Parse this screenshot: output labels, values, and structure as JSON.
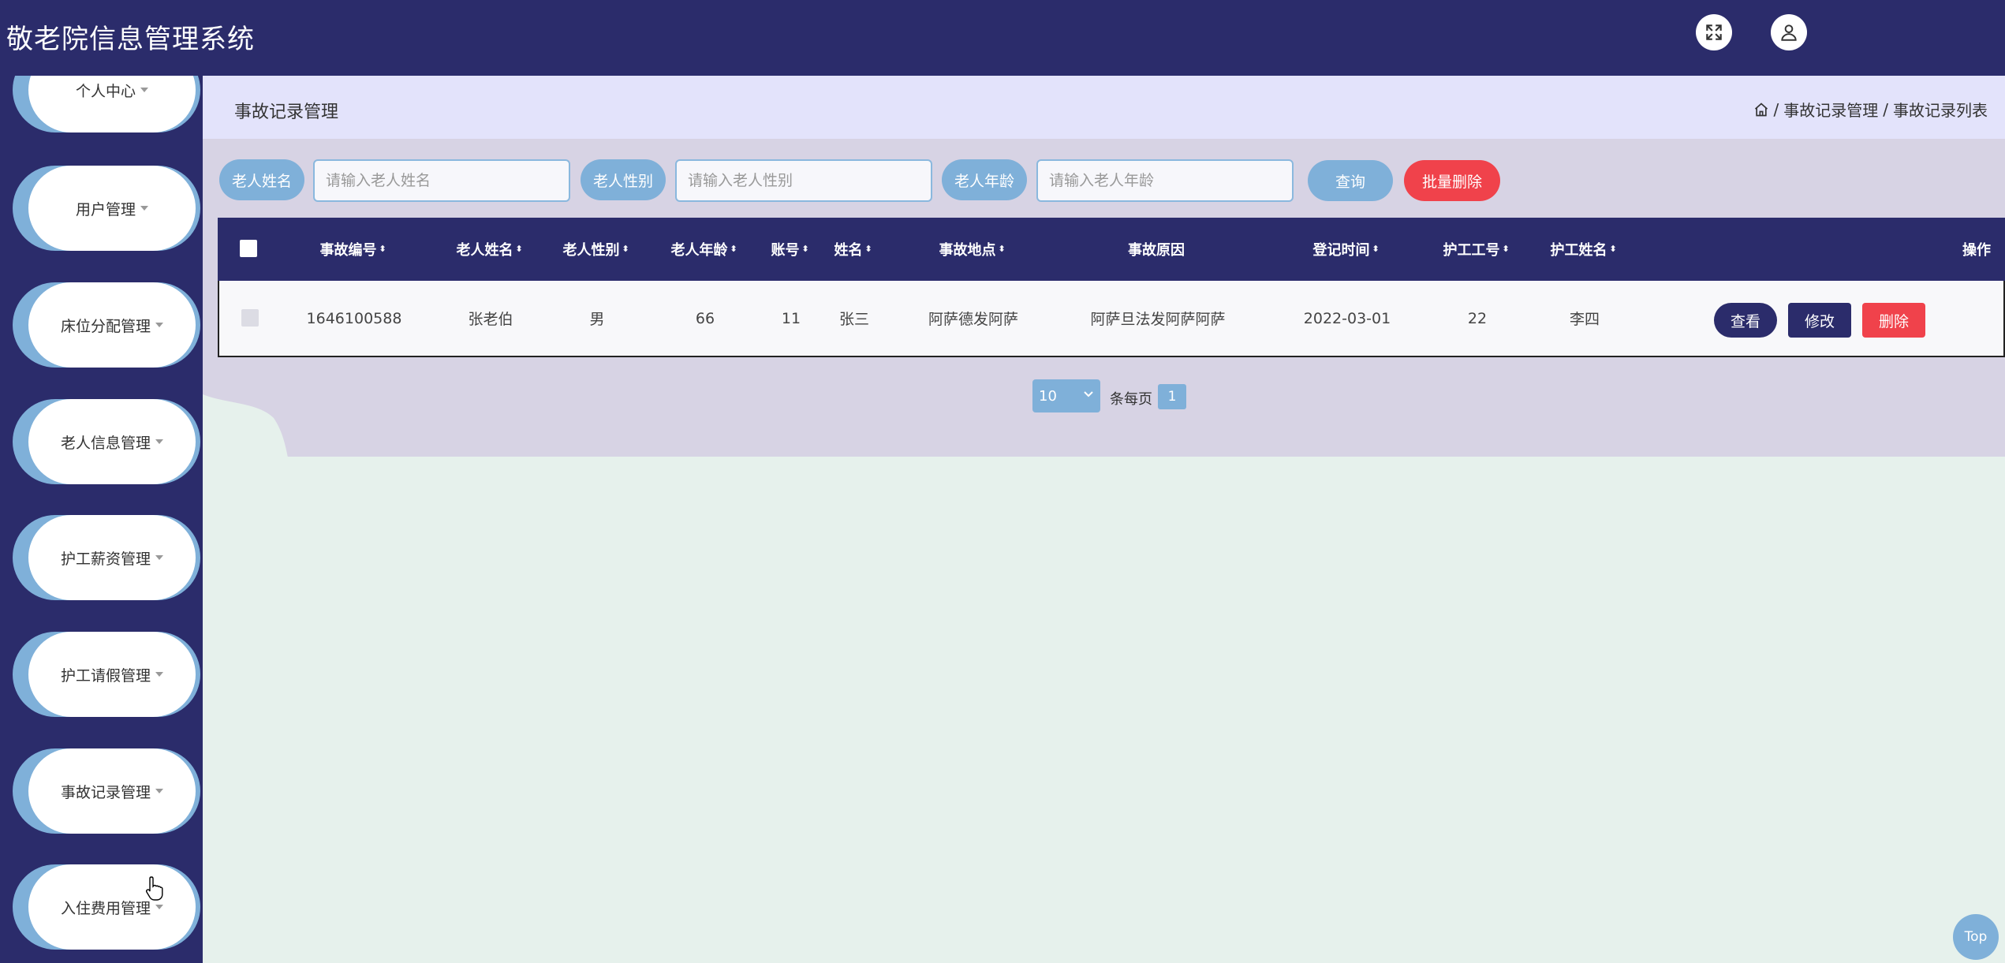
{
  "app": {
    "title": "敬老院信息管理系统"
  },
  "topbar": {
    "fullscreen_icon": "fullscreen-icon",
    "user_icon": "user-icon"
  },
  "sidebar": {
    "items": [
      {
        "label": "个人中心"
      },
      {
        "label": "用户管理"
      },
      {
        "label": "床位分配管理"
      },
      {
        "label": "老人信息管理"
      },
      {
        "label": "护工薪资管理"
      },
      {
        "label": "护工请假管理"
      },
      {
        "label": "事故记录管理"
      },
      {
        "label": "入住费用管理"
      }
    ]
  },
  "page": {
    "title": "事故记录管理",
    "breadcrumb": {
      "home_icon": "home-icon",
      "sep": "/",
      "level1": "事故记录管理",
      "level2": "事故记录列表"
    }
  },
  "search": {
    "name_label": "老人姓名",
    "name_placeholder": "请输入老人姓名",
    "gender_label": "老人性别",
    "gender_placeholder": "请输入老人性别",
    "age_label": "老人年龄",
    "age_placeholder": "请输入老人年龄",
    "query_button": "查询",
    "batch_delete_button": "批量删除"
  },
  "table": {
    "columns": [
      "事故编号",
      "老人姓名",
      "老人性别",
      "老人年龄",
      "账号",
      "姓名",
      "事故地点",
      "事故原因",
      "登记时间",
      "护工工号",
      "护工姓名",
      "操作"
    ],
    "rows": [
      {
        "cells": [
          "1646100588",
          "张老伯",
          "男",
          "66",
          "11",
          "张三",
          "阿萨德发阿萨",
          "阿萨旦法发阿萨阿萨",
          "2022-03-01",
          "22",
          "李四"
        ],
        "actions": {
          "view": "查看",
          "edit": "修改",
          "delete": "删除"
        }
      }
    ]
  },
  "pagination": {
    "page_size": "10",
    "per_page_label": "条每页",
    "current_page": "1"
  },
  "scroll_top": {
    "label": "Top"
  },
  "colors": {
    "navy": "#2b2c6b",
    "light_blue": "#7fb0d9",
    "red": "#f0424b",
    "lavender": "#d7d3e4",
    "mint": "#e6f1ec"
  }
}
